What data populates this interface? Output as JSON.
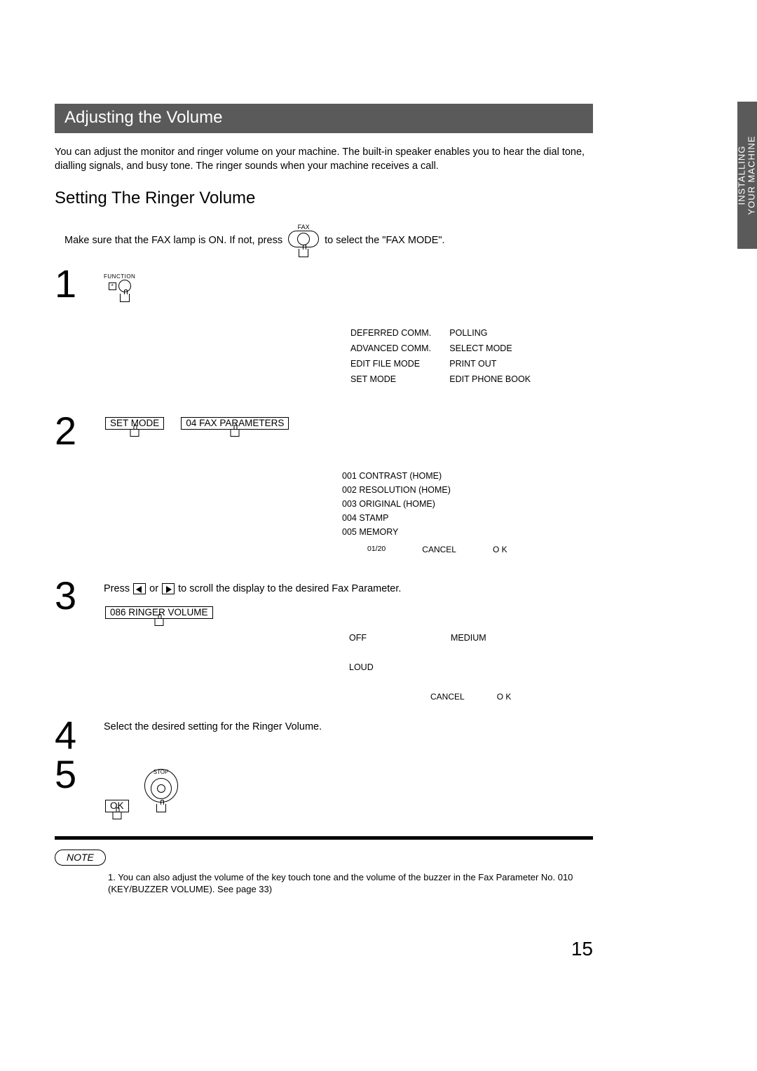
{
  "tab": {
    "line1": "INSTALLING",
    "line2": "YOUR MACHINE"
  },
  "title": "Adjusting the Volume",
  "intro": "You can adjust the monitor and ringer volume on your machine. The built-in speaker enables you to hear the dial tone, dialling signals, and busy tone. The ringer sounds when your machine receives a call.",
  "subhead": "Setting The Ringer Volume",
  "modeline": {
    "pre": "Make sure that the FAX lamp is ON.  If not, press",
    "btn_label": "FAX",
    "post": "to select the \"FAX MODE\"."
  },
  "step1": {
    "num": "1",
    "func_label": "FUNCTION"
  },
  "menu": {
    "rows": [
      [
        "DEFERRED COMM.",
        "POLLING"
      ],
      [
        "ADVANCED COMM.",
        "SELECT MODE"
      ],
      [
        "EDIT FILE MODE",
        "PRINT OUT"
      ],
      [
        "SET MODE",
        "EDIT PHONE BOOK"
      ]
    ]
  },
  "step2": {
    "num": "2",
    "key1": "SET MODE",
    "key2": "04 FAX PARAMETERS",
    "params": [
      "001 CONTRAST (HOME)",
      "002 RESOLUTION (HOME)",
      "003 ORIGINAL (HOME)",
      "004 STAMP",
      "005 MEMORY"
    ],
    "footer": {
      "page": "01/20",
      "cancel": "CANCEL",
      "ok": "O K"
    }
  },
  "step3": {
    "num": "3",
    "text_pre": "Press ",
    "text_mid": " or ",
    "text_post": " to scroll the display to the desired Fax Parameter.",
    "key": "086 RINGER VOLUME",
    "opts": {
      "off": "OFF",
      "medium": "MEDIUM",
      "loud": "LOUD"
    },
    "footer": {
      "cancel": "CANCEL",
      "ok": "O K"
    }
  },
  "step4": {
    "num": "4",
    "text": "Select the desired setting for the Ringer Volume."
  },
  "step5": {
    "num": "5",
    "ok": "OK",
    "stop": "STOP"
  },
  "note": {
    "label": "NOTE",
    "item": "1.  You can also adjust the volume of the key touch tone and the volume of the buzzer in the Fax Parameter No. 010 (KEY/BUZZER VOLUME).  See page 33)"
  },
  "pagenum": "15"
}
